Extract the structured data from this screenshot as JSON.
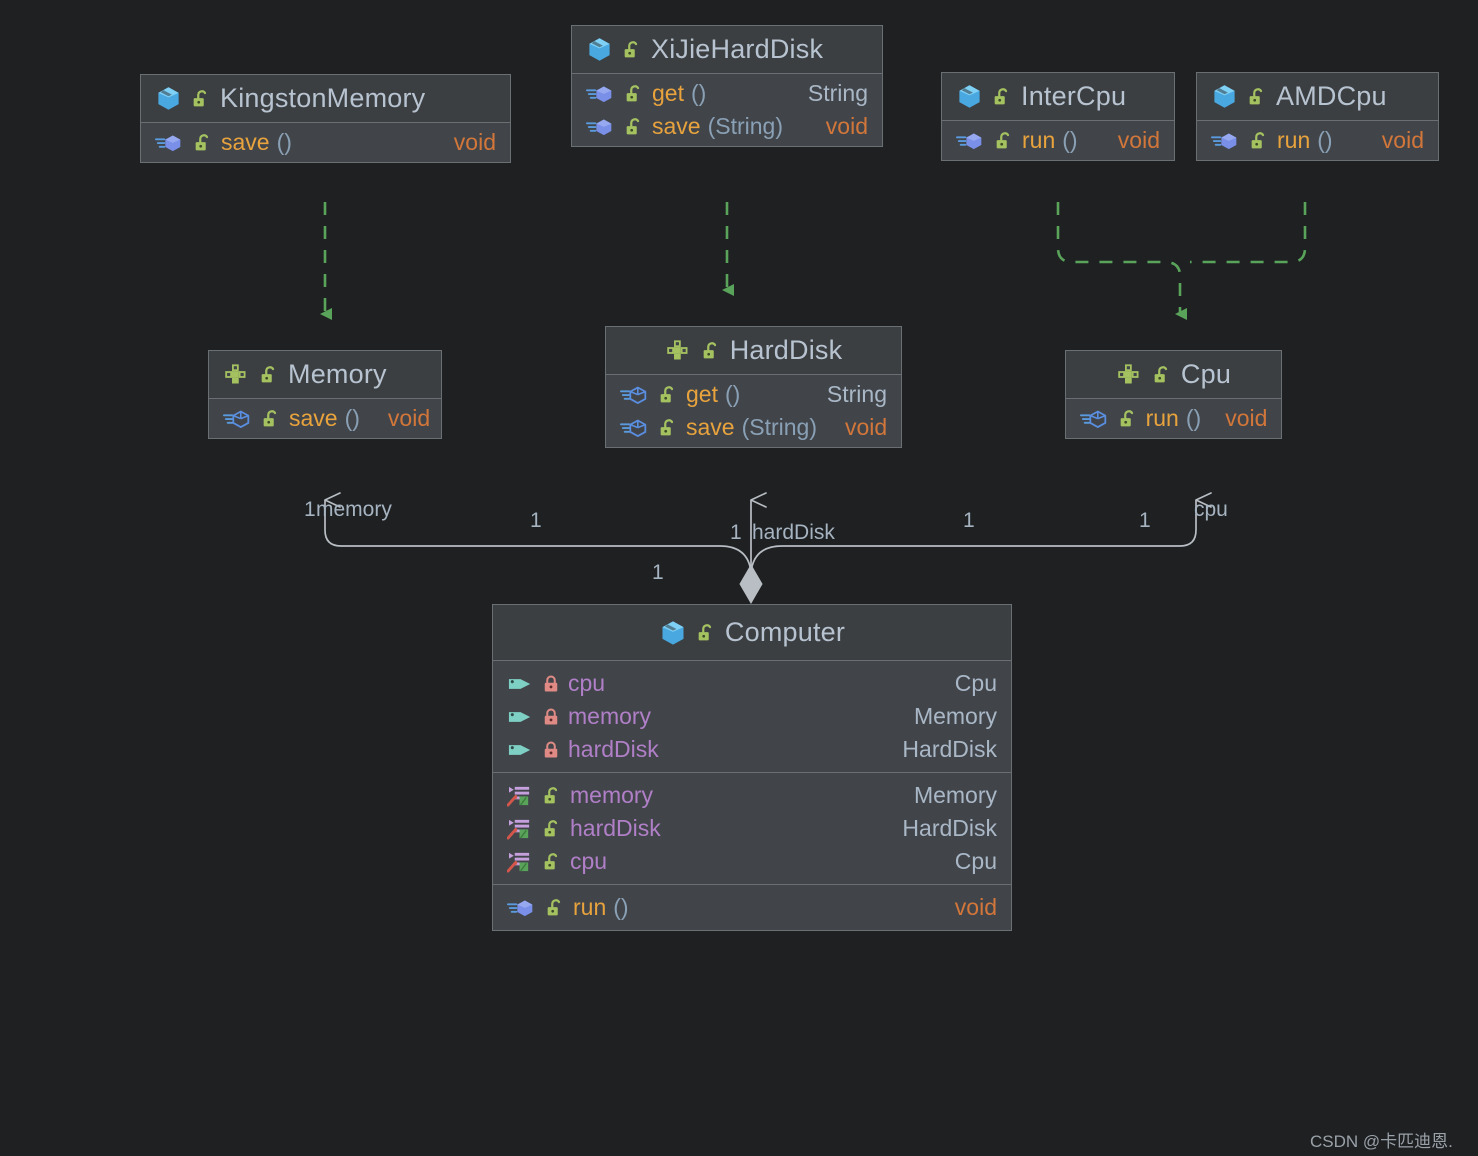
{
  "theme": {
    "background": "#1e2022",
    "node_body": "#41454a",
    "node_header": "#3c3f41",
    "node_border": "#6a6f73",
    "title_text": "#b7c3d0",
    "method_name": "#e8a33d",
    "void_type": "#d2763a",
    "field_name": "#b07fc7",
    "type_text": "#a9b7c6",
    "inherit_edge": "#5aa35a",
    "assoc_edge": "#b9bec4"
  },
  "nodes": {
    "kingston_memory": {
      "title": "KingstonMemory",
      "stereotype": "class",
      "members": [
        {
          "icon": "class-method-icon",
          "lock": "unlock-green",
          "name": "save",
          "args": "()",
          "type": "void",
          "type_kind": "void"
        }
      ]
    },
    "xijie_harddisk": {
      "title": "XiJieHardDisk",
      "stereotype": "class",
      "members": [
        {
          "icon": "class-method-icon",
          "lock": "unlock-green",
          "name": "get",
          "args": "()",
          "type": "String",
          "type_kind": "type"
        },
        {
          "icon": "class-method-icon",
          "lock": "unlock-green",
          "name": "save",
          "args": "(String)",
          "type": "void",
          "type_kind": "void"
        }
      ]
    },
    "inter_cpu": {
      "title": "InterCpu",
      "stereotype": "class",
      "members": [
        {
          "icon": "class-method-icon",
          "lock": "unlock-green",
          "name": "run",
          "args": "()",
          "type": "void",
          "type_kind": "void"
        }
      ]
    },
    "amd_cpu": {
      "title": "AMDCpu",
      "stereotype": "class",
      "members": [
        {
          "icon": "class-method-icon",
          "lock": "unlock-green",
          "name": "run",
          "args": "()",
          "type": "void",
          "type_kind": "void"
        }
      ]
    },
    "memory": {
      "title": "Memory",
      "stereotype": "interface",
      "members": [
        {
          "icon": "interface-method-icon",
          "lock": "unlock-green",
          "name": "save",
          "args": "()",
          "type": "void",
          "type_kind": "void"
        }
      ]
    },
    "harddisk": {
      "title": "HardDisk",
      "stereotype": "interface",
      "members": [
        {
          "icon": "interface-method-icon",
          "lock": "unlock-green",
          "name": "get",
          "args": "()",
          "type": "String",
          "type_kind": "type"
        },
        {
          "icon": "interface-method-icon",
          "lock": "unlock-green",
          "name": "save",
          "args": "(String)",
          "type": "void",
          "type_kind": "void"
        }
      ]
    },
    "cpu": {
      "title": "Cpu",
      "stereotype": "interface",
      "members": [
        {
          "icon": "interface-method-icon",
          "lock": "unlock-green",
          "name": "run",
          "args": "()",
          "type": "void",
          "type_kind": "void"
        }
      ]
    },
    "computer": {
      "title": "Computer",
      "stereotype": "class",
      "fields": [
        {
          "icon": "field-icon",
          "lock": "lock-red",
          "name": "cpu",
          "type": "Cpu"
        },
        {
          "icon": "field-icon",
          "lock": "lock-red",
          "name": "memory",
          "type": "Memory"
        },
        {
          "icon": "field-icon",
          "lock": "lock-red",
          "name": "hardDisk",
          "type": "HardDisk"
        }
      ],
      "properties": [
        {
          "icon": "property-icon",
          "lock": "unlock-green",
          "name": "memory",
          "type": "Memory"
        },
        {
          "icon": "property-icon",
          "lock": "unlock-green",
          "name": "hardDisk",
          "type": "HardDisk"
        },
        {
          "icon": "property-icon",
          "lock": "unlock-green",
          "name": "cpu",
          "type": "Cpu"
        }
      ],
      "methods": [
        {
          "icon": "class-method-icon",
          "lock": "unlock-green",
          "name": "run",
          "args": "()",
          "type": "void",
          "type_kind": "void"
        }
      ]
    }
  },
  "edge_labels": {
    "memory_mult_near": "1",
    "memory_role": "memory",
    "memory_mult_far": "1",
    "harddisk_mult_near": "1",
    "harddisk_role": "hardDisk",
    "harddisk_mult_far": "1",
    "cpu_mult_near": "1",
    "cpu_role": "cpu",
    "cpu_mult_far": "1",
    "computer_mult": "1"
  },
  "watermark": {
    "text": "CSDN @卡匹迪恩."
  }
}
